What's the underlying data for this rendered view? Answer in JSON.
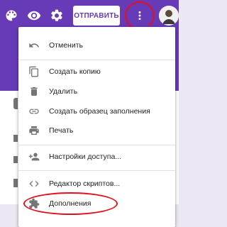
{
  "header": {
    "send_label": "ОТПРАВИТЬ",
    "icons": [
      "palette-icon",
      "eye-icon",
      "gear-icon",
      "more-vert-icon",
      "avatar"
    ],
    "brand_color": "#673ab7",
    "highlight_color": "#e0121f"
  },
  "menu": {
    "items": [
      {
        "label": "Отменить",
        "icon": "undo-icon"
      },
      {
        "label": "Создать копию",
        "icon": "copy-icon"
      },
      {
        "label": "Удалить",
        "icon": "trash-icon"
      },
      {
        "label": "Создать образец заполнения",
        "icon": "link-icon"
      },
      {
        "label": "Печать",
        "icon": "printer-icon"
      },
      {
        "label": "Настройки доступа...",
        "icon": "add-people-icon"
      },
      {
        "label": "Редактор скриптов...",
        "icon": "code-icon"
      },
      {
        "label": "Дополнения",
        "icon": "puzzle-icon"
      }
    ]
  }
}
